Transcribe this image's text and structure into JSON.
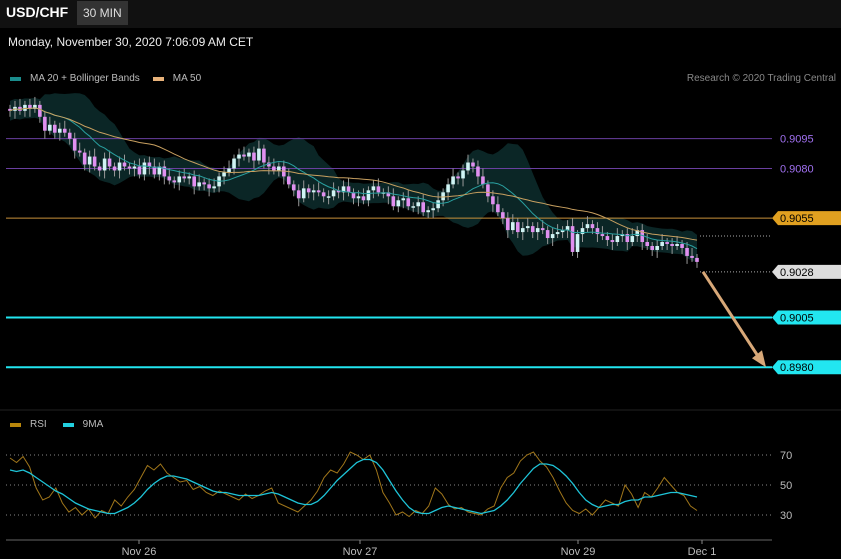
{
  "header": {
    "symbol": "USD/CHF",
    "timeframe": "30 MIN"
  },
  "timestamp": "Monday, November 30, 2020 7:06:09 AM CET",
  "legend_main": [
    {
      "label": "MA 20 + Bollinger Bands",
      "color": "#1a8c8c"
    },
    {
      "label": "MA 50",
      "color": "#e8b27a"
    }
  ],
  "credit": "Research © 2020 Trading Central",
  "legend_rsi": [
    {
      "label": "RSI",
      "color": "#b8860b"
    },
    {
      "label": "9MA",
      "color": "#22d0e0"
    }
  ],
  "colors": {
    "up": "#d0f4f4",
    "down": "#e090f0",
    "ma20": "#2aa0a0",
    "ma50": "#c8a060",
    "band": "#0c2a2a",
    "accent_cyan": "#22e6f0",
    "accent_orange": "#e0a020",
    "accent_purple": "#a070f0"
  },
  "chart_data": [
    {
      "type": "candlestick",
      "title": "",
      "ylim": [
        8960,
        9122
      ],
      "y_unit": "pips (x0.0001)",
      "x_ticks": [
        "Nov 26",
        "Nov 27",
        "Nov 29",
        "Dec 1"
      ],
      "levels": [
        {
          "value": "0.9095",
          "style": "purple"
        },
        {
          "value": "0.9080",
          "style": "purple"
        },
        {
          "value": "0.9055",
          "style": "orange"
        },
        {
          "value": "0.9028",
          "style": "gray"
        },
        {
          "value": "0.9005",
          "style": "cyan"
        },
        {
          "value": "0.8980",
          "style": "cyan"
        }
      ],
      "closes": [
        9109,
        9111,
        9109,
        9112,
        9110,
        9112,
        9106,
        9099,
        9102,
        9098,
        9100,
        9098,
        9095,
        9089,
        9088,
        9082,
        9086,
        9081,
        9079,
        9085,
        9081,
        9079,
        9083,
        9081,
        9080,
        9081,
        9077,
        9083,
        9081,
        9077,
        9081,
        9076,
        9074,
        9073,
        9076,
        9075,
        9076,
        9071,
        9073,
        9072,
        9070,
        9071,
        9076,
        9078,
        9080,
        9085,
        9087,
        9086,
        9088,
        9084,
        9090,
        9083,
        9081,
        9079,
        9081,
        9076,
        9072,
        9069,
        9065,
        9070,
        9068,
        9069,
        9068,
        9066,
        9066,
        9069,
        9068,
        9071,
        9068,
        9065,
        9066,
        9064,
        9069,
        9071,
        9068,
        9068,
        9066,
        9061,
        9064,
        9065,
        9061,
        9061,
        9063,
        9058,
        9059,
        9060,
        9064,
        9068,
        9072,
        9076,
        9075,
        9079,
        9083,
        9081,
        9076,
        9072,
        9066,
        9062,
        9058,
        9055,
        9049,
        9053,
        9048,
        9050,
        9051,
        9048,
        9050,
        9049,
        9045,
        9047,
        9048,
        9049,
        9051,
        9038,
        9047,
        9050,
        9052,
        9050,
        9047,
        9046,
        9044,
        9043,
        9046,
        9047,
        9043,
        9046,
        9049,
        9043,
        9041,
        9039,
        9041,
        9043,
        9042,
        9041,
        9042,
        9040,
        9036,
        9035,
        9033
      ],
      "ma20_start": 9112,
      "ma20_end": 9040,
      "ma50_start": 9109,
      "ma50_end": 9048,
      "forecast": {
        "from": "0.9028",
        "to": "0.8980"
      }
    },
    {
      "type": "line",
      "title": "",
      "ylim": [
        20,
        80
      ],
      "y_ticks": [
        "70",
        "50",
        "30"
      ],
      "series": [
        {
          "name": "RSI",
          "values": [
            68,
            65,
            69,
            62,
            48,
            40,
            42,
            48,
            38,
            32,
            35,
            30,
            34,
            28,
            33,
            31,
            40,
            36,
            42,
            47,
            55,
            63,
            60,
            64,
            58,
            55,
            52,
            53,
            47,
            49,
            45,
            43,
            46,
            44,
            42,
            40,
            44,
            41,
            43,
            46,
            48,
            38,
            36,
            34,
            32,
            36,
            40,
            46,
            55,
            60,
            58,
            64,
            72,
            70,
            67,
            70,
            60,
            45,
            38,
            30,
            32,
            29,
            33,
            31,
            36,
            48,
            44,
            37,
            34,
            35,
            32,
            31,
            30,
            34,
            36,
            48,
            55,
            58,
            66,
            70,
            72,
            66,
            62,
            55,
            46,
            38,
            33,
            31,
            34,
            30,
            35,
            40,
            38,
            36,
            50,
            44,
            35,
            45,
            42,
            48,
            55,
            50,
            45,
            43,
            36,
            33
          ]
        },
        {
          "name": "9MA",
          "values": [
            60,
            59,
            60,
            58,
            55,
            52,
            49,
            46,
            44,
            41,
            38,
            36,
            34,
            33,
            32,
            31,
            31,
            33,
            35,
            38,
            42,
            47,
            51,
            54,
            56,
            56,
            55,
            54,
            52,
            50,
            48,
            46,
            45,
            45,
            44,
            43,
            43,
            43,
            43,
            44,
            45,
            44,
            42,
            40,
            38,
            37,
            37,
            39,
            43,
            48,
            53,
            57,
            61,
            65,
            67,
            67,
            65,
            60,
            53,
            46,
            40,
            35,
            32,
            31,
            31,
            33,
            35,
            36,
            35,
            34,
            33,
            32,
            31,
            32,
            33,
            36,
            40,
            45,
            51,
            56,
            61,
            64,
            64,
            63,
            60,
            56,
            51,
            45,
            40,
            37,
            35,
            36,
            37,
            37,
            39,
            40,
            40,
            42,
            42,
            43,
            44,
            45,
            45,
            44,
            43,
            42
          ]
        }
      ]
    }
  ]
}
